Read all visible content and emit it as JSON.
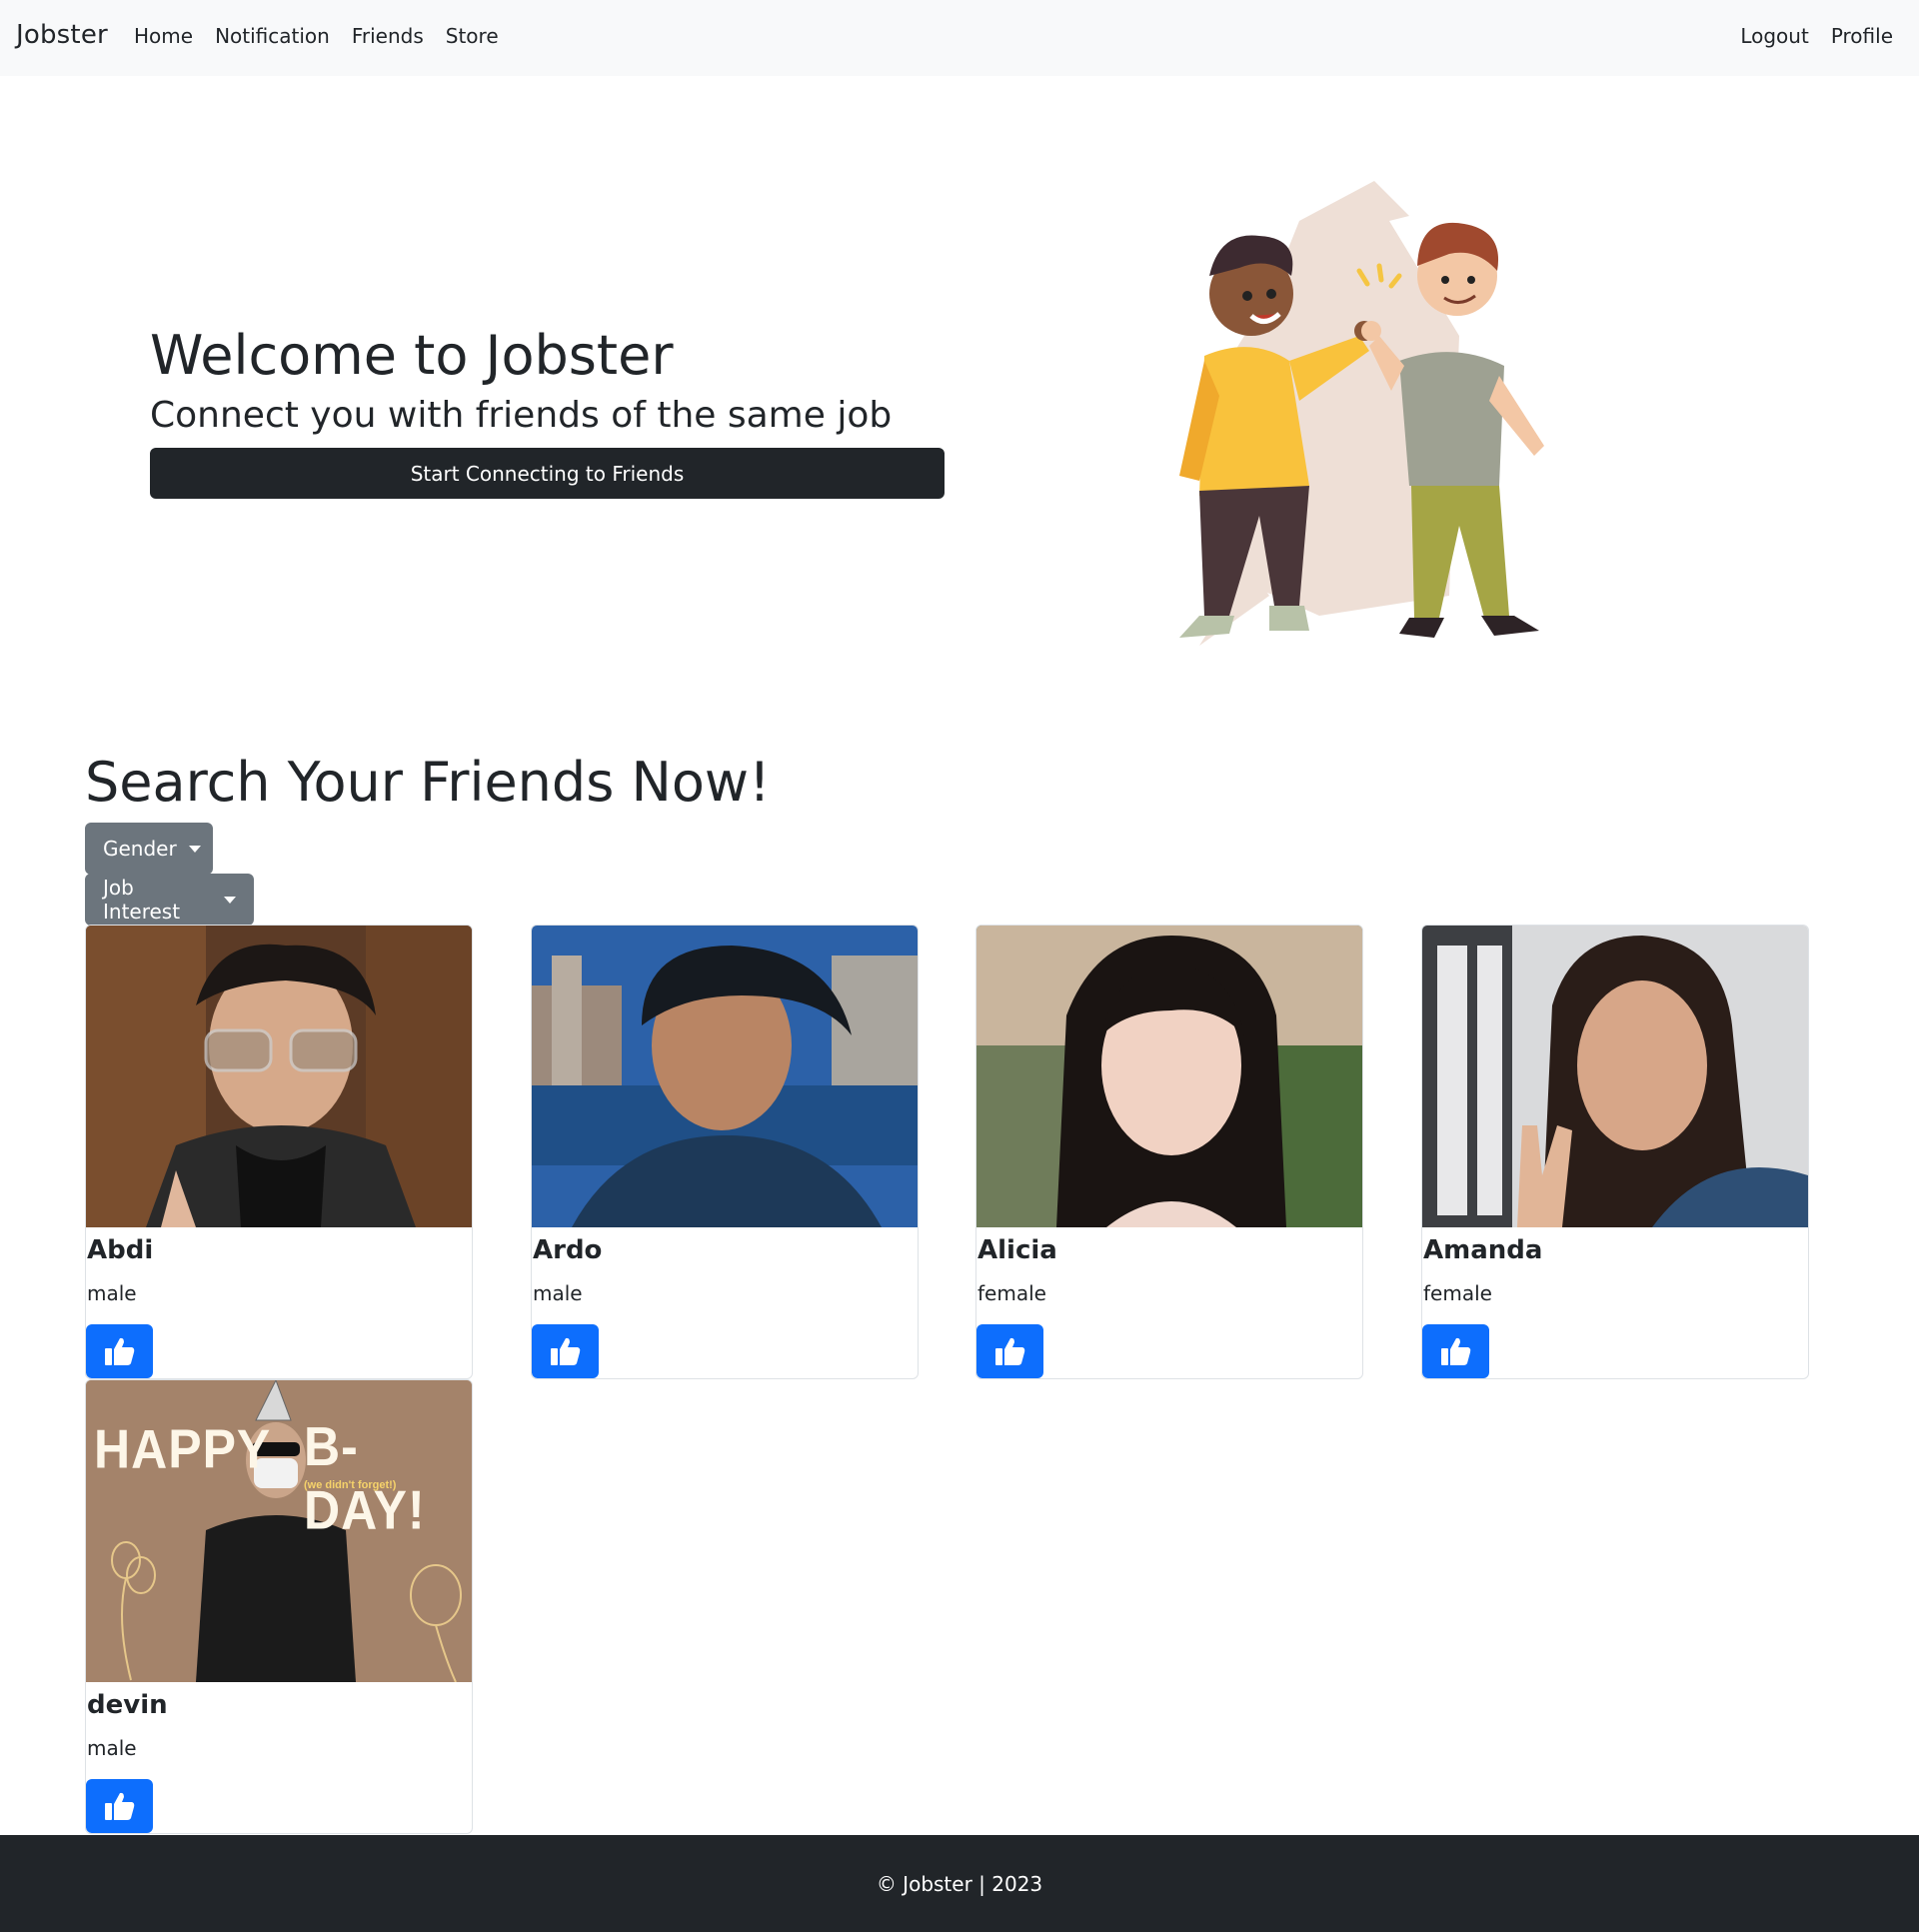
{
  "nav": {
    "brand": "Jobster",
    "left_links": [
      "Home",
      "Notification",
      "Friends",
      "Store"
    ],
    "right_links": [
      "Logout",
      "Profile"
    ]
  },
  "hero": {
    "title": "Welcome to Jobster",
    "subtitle": "Connect you with friends of the same job",
    "cta_label": "Start Connecting to Friends",
    "illustration_icon": "high-five-illustration"
  },
  "search": {
    "title": "Search Your Friends Now!",
    "gender_dropdown": "Gender",
    "job_dropdown": "Job Interest"
  },
  "friends": [
    {
      "name": "Abdi",
      "gender": "male",
      "photo_icon": "photo-man-glasses"
    },
    {
      "name": "Ardo",
      "gender": "male",
      "photo_icon": "photo-man-city"
    },
    {
      "name": "Alicia",
      "gender": "female",
      "photo_icon": "photo-woman-bangs"
    },
    {
      "name": "Amanda",
      "gender": "female",
      "photo_icon": "photo-woman-peace"
    },
    {
      "name": "devin",
      "gender": "male",
      "photo_icon": "photo-birthday-card"
    }
  ],
  "birthday_card": {
    "left_text": "HAPPY",
    "right_text": "B-DAY!",
    "small_text": "(we didn't forget!)"
  },
  "footer": {
    "text": "© Jobster | 2023"
  },
  "colors": {
    "primary": "#0d6efd",
    "dark": "#212529",
    "secondary": "#6c757d",
    "navbar_bg": "#f8f9fa"
  }
}
